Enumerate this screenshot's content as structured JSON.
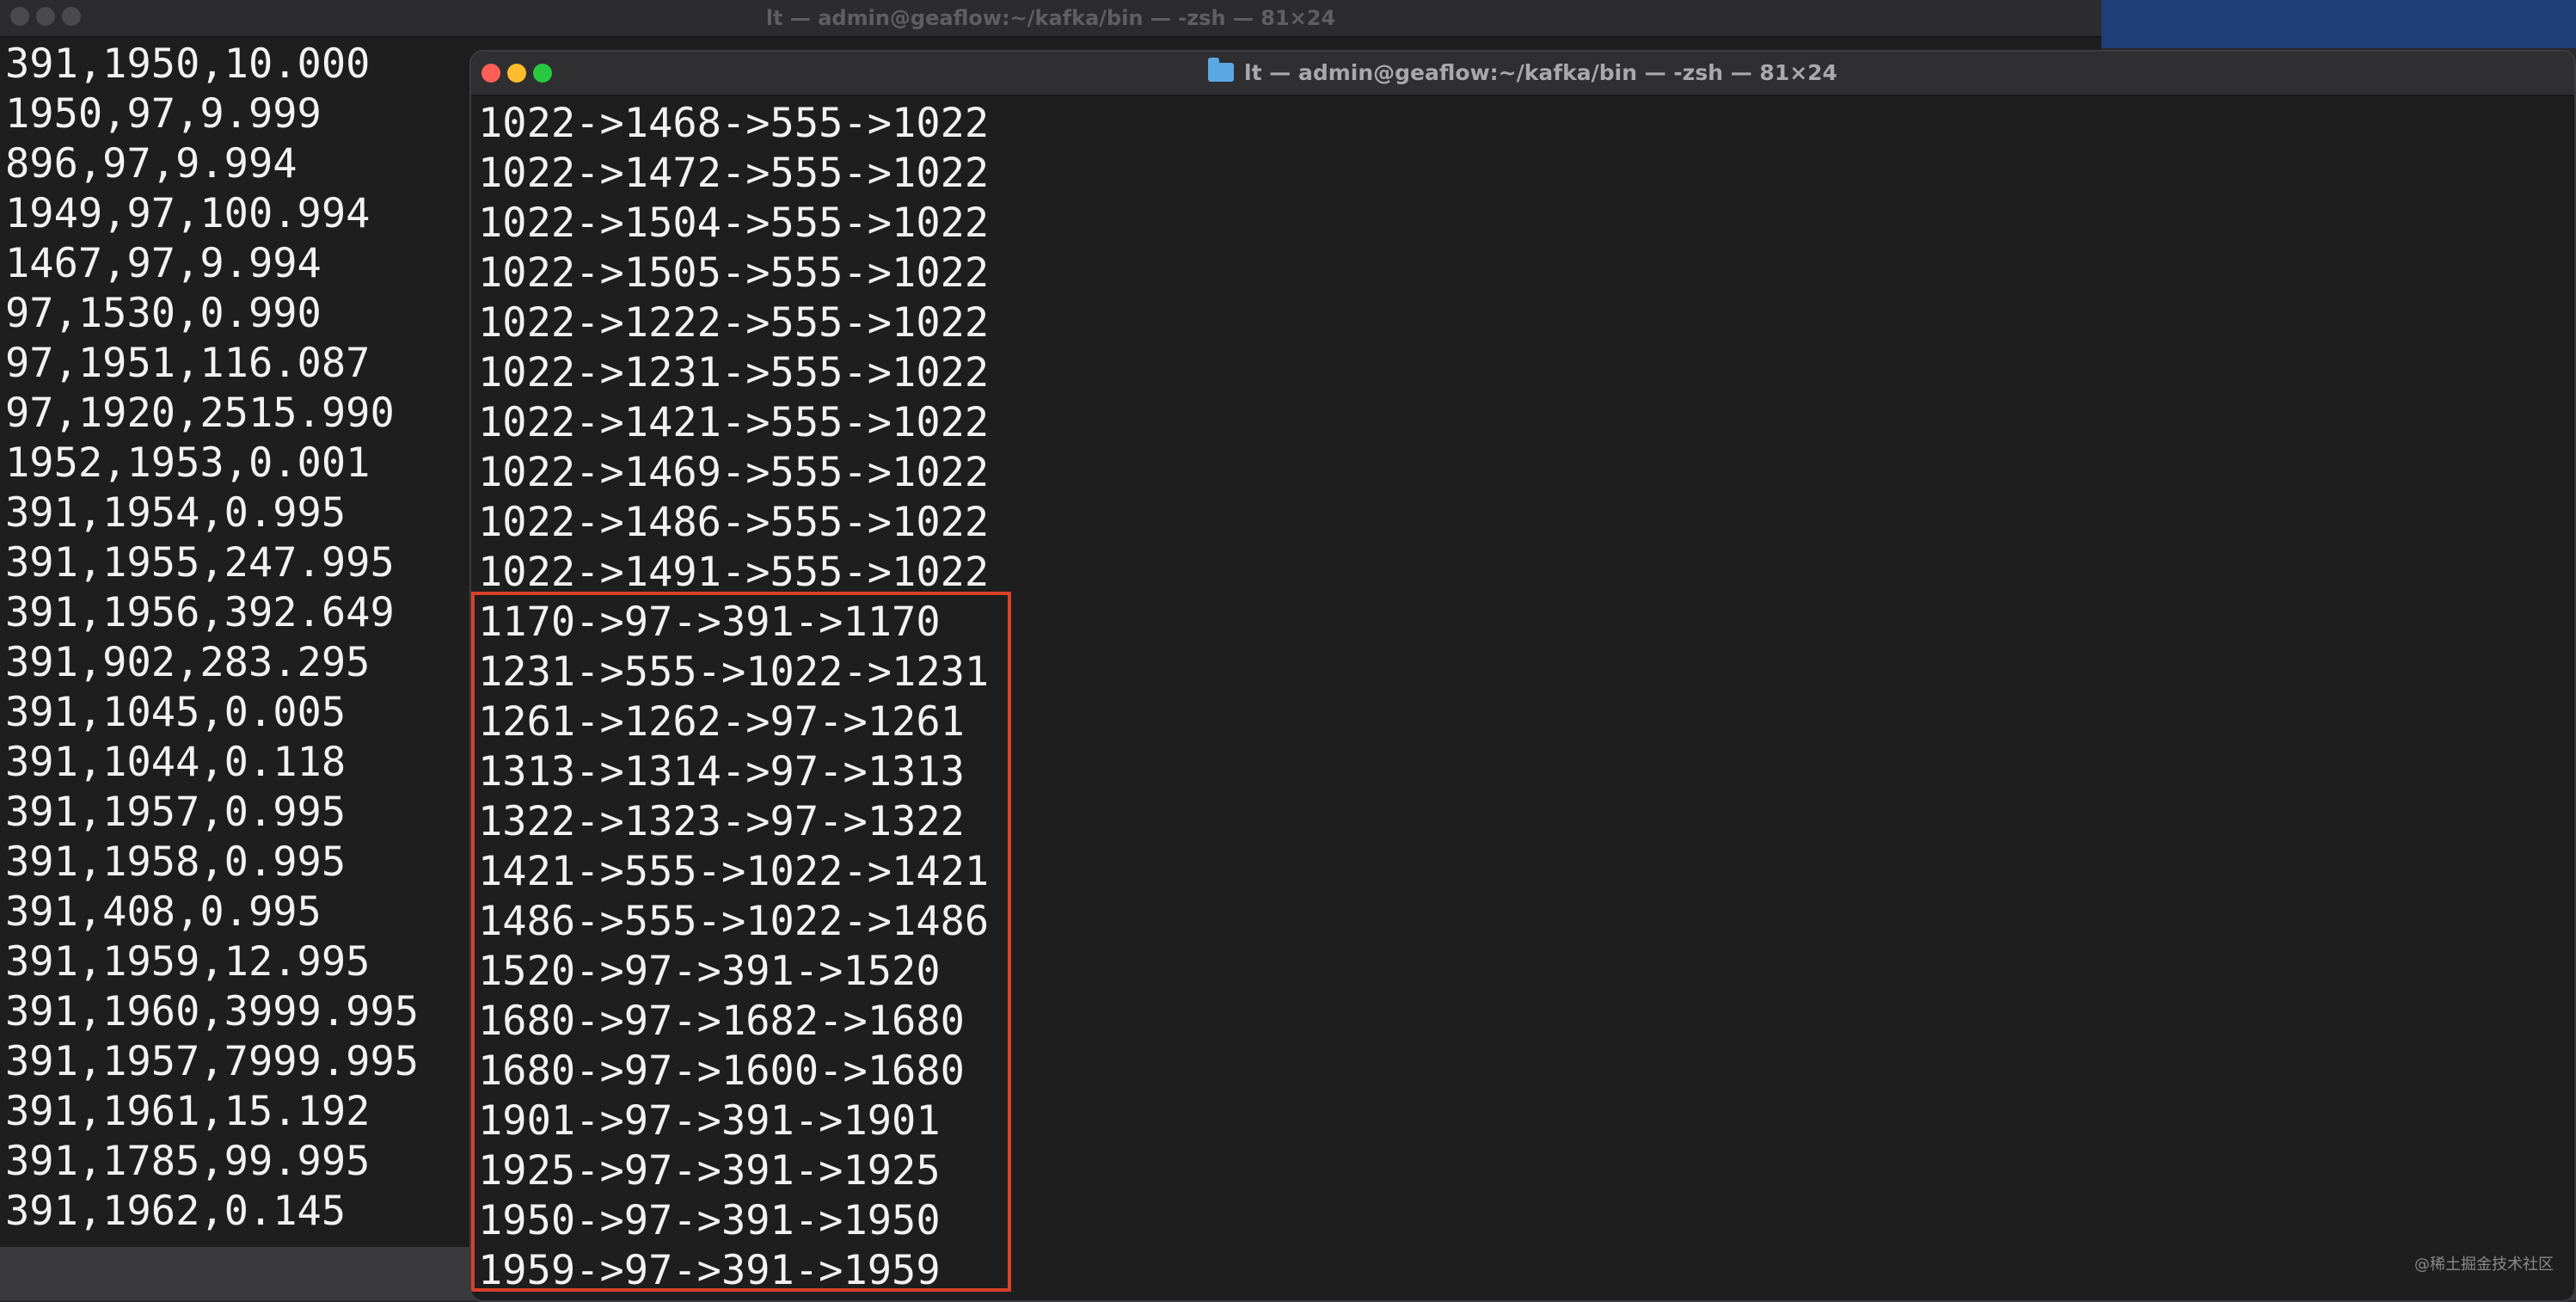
{
  "background_window": {
    "title": "lt — admin@geaflow:~/kafka/bin — -zsh — 81×24",
    "lines": [
      "391,1950,10.000",
      "1950,97,9.999",
      "896,97,9.994",
      "1949,97,100.994",
      "1467,97,9.994",
      "97,1530,0.990",
      "97,1951,116.087",
      "97,1920,2515.990",
      "1952,1953,0.001",
      "391,1954,0.995",
      "391,1955,247.995",
      "391,1956,392.649",
      "391,902,283.295",
      "391,1045,0.005",
      "391,1044,0.118",
      "391,1957,0.995",
      "391,1958,0.995",
      "391,408,0.995",
      "391,1959,12.995",
      "391,1960,3999.995",
      "391,1957,7999.995",
      "391,1961,15.192",
      "391,1785,99.995",
      "391,1962,0.145"
    ]
  },
  "foreground_window": {
    "title": "lt — admin@geaflow:~/kafka/bin — -zsh — 81×24",
    "title_icon": "folder-icon",
    "lines": [
      "1022->1468->555->1022",
      "1022->1472->555->1022",
      "1022->1504->555->1022",
      "1022->1505->555->1022",
      "1022->1222->555->1022",
      "1022->1231->555->1022",
      "1022->1421->555->1022",
      "1022->1469->555->1022",
      "1022->1486->555->1022",
      "1022->1491->555->1022",
      "1170->97->391->1170",
      "1231->555->1022->1231",
      "1261->1262->97->1261",
      "1313->1314->97->1313",
      "1322->1323->97->1322",
      "1421->555->1022->1421",
      "1486->555->1022->1486",
      "1520->97->391->1520",
      "1680->97->1682->1680",
      "1680->97->1600->1680",
      "1901->97->391->1901",
      "1925->97->391->1925",
      "1950->97->391->1950",
      "1959->97->391->1959"
    ],
    "highlight_color": "#d8422b"
  },
  "watermark": "@稀土掘金技术社区",
  "colors": {
    "terminal_bg": "#1e1e1e",
    "text": "#f2f2f2",
    "close": "#ff5f57",
    "minimize": "#febc2e",
    "zoom": "#28c840"
  }
}
